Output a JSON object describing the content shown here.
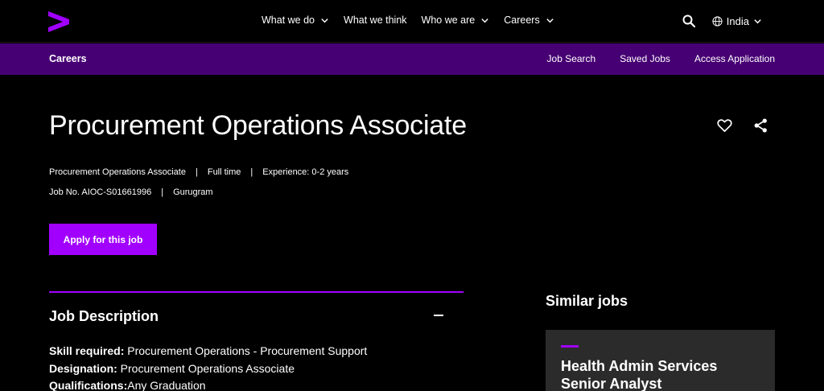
{
  "nav": {
    "items": [
      {
        "label": "What we do",
        "dropdown": true
      },
      {
        "label": "What we think",
        "dropdown": false
      },
      {
        "label": "Who we are",
        "dropdown": true
      },
      {
        "label": "Careers",
        "dropdown": true
      }
    ],
    "region": "India"
  },
  "subnav": {
    "brand": "Careers",
    "links": [
      "Job Search",
      "Saved Jobs",
      "Access Application"
    ]
  },
  "job": {
    "title": "Procurement Operations Associate",
    "role": "Procurement Operations Associate",
    "type": "Full time",
    "experience": "Experience: 0-2 years",
    "job_no": "Job No. AIOC-S01661996",
    "location": "Gurugram",
    "separator": "|",
    "apply_label": "Apply for this job"
  },
  "description": {
    "heading": "Job Description",
    "lines": [
      {
        "label": "Skill required:",
        "value": " Procurement Operations - Procurement Support"
      },
      {
        "label": "Designation:",
        "value": " Procurement Operations Associate"
      },
      {
        "label": "Qualifications:",
        "value": "Any Graduation"
      }
    ]
  },
  "similar": {
    "heading": "Similar jobs",
    "cards": [
      {
        "title": "Health Admin Services Senior Analyst"
      }
    ]
  },
  "colors": {
    "accent": "#a100ff",
    "subnav_bg": "#460073",
    "card_bg": "#2b2b2b",
    "background": "#000000"
  }
}
